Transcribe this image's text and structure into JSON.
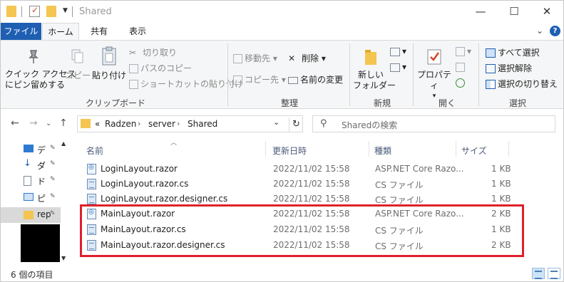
{
  "window": {
    "title": "Shared",
    "controls": {
      "minimize": "—",
      "maximize": "☐",
      "close": "✕"
    }
  },
  "ribbon_tabs": {
    "file": "ファイル",
    "home": "ホーム",
    "share": "共有",
    "view": "表示"
  },
  "ribbon": {
    "clipboard": {
      "pin": "クイック アクセス\nにピン留めする",
      "copy": "コピー",
      "paste": "貼り付け",
      "cut": "切り取り",
      "copy_path": "パスのコピー",
      "paste_shortcut": "ショートカットの貼り付け",
      "label": "クリップボード"
    },
    "organize": {
      "move_to": "移動先",
      "copy_to": "コピー先",
      "delete": "削除",
      "rename": "名前の変更",
      "label": "整理"
    },
    "new": {
      "new_folder": "新しい\nフォルダー",
      "label": "新規"
    },
    "open": {
      "properties": "プロパティ",
      "label": "開く"
    },
    "select": {
      "select_all": "すべて選択",
      "select_none": "選択解除",
      "invert": "選択の切り替え",
      "label": "選択"
    }
  },
  "address": {
    "prefix": "«",
    "crumbs": [
      "Radzen",
      "server",
      "Shared"
    ],
    "separator": "›"
  },
  "search": {
    "placeholder": "Sharedの検索"
  },
  "nav_pane": {
    "items": [
      {
        "label": "デ",
        "icon": "desktop-icon"
      },
      {
        "label": "ダ",
        "icon": "download-icon"
      },
      {
        "label": "ド",
        "icon": "document-icon"
      },
      {
        "label": "ピ",
        "icon": "picture-icon"
      },
      {
        "label": "rep",
        "icon": "folder-icon"
      }
    ]
  },
  "columns": {
    "name": "名前",
    "date": "更新日時",
    "type": "種類",
    "size": "サイズ"
  },
  "files": [
    {
      "name": "LoginLayout.razor",
      "date": "2022/11/02 15:58",
      "type": "ASP.NET Core Razo...",
      "size": "1 KB",
      "icon": "razor-file-icon"
    },
    {
      "name": "LoginLayout.razor.cs",
      "date": "2022/11/02 15:58",
      "type": "CS ファイル",
      "size": "1 KB",
      "icon": "cs-file-icon"
    },
    {
      "name": "LoginLayout.razor.designer.cs",
      "date": "2022/11/02 15:58",
      "type": "CS ファイル",
      "size": "1 KB",
      "icon": "cs-file-icon"
    },
    {
      "name": "MainLayout.razor",
      "date": "2022/11/02 15:58",
      "type": "ASP.NET Core Razo...",
      "size": "2 KB",
      "icon": "razor-file-icon"
    },
    {
      "name": "MainLayout.razor.cs",
      "date": "2022/11/02 15:58",
      "type": "CS ファイル",
      "size": "1 KB",
      "icon": "cs-file-icon"
    },
    {
      "name": "MainLayout.razor.designer.cs",
      "date": "2022/11/02 15:58",
      "type": "CS ファイル",
      "size": "2 KB",
      "icon": "cs-file-icon"
    }
  ],
  "status": {
    "item_count": "6 個の項目"
  },
  "colors": {
    "accent": "#1e5fb3",
    "highlight_border": "#e0202c",
    "folder": "#f4c550"
  }
}
